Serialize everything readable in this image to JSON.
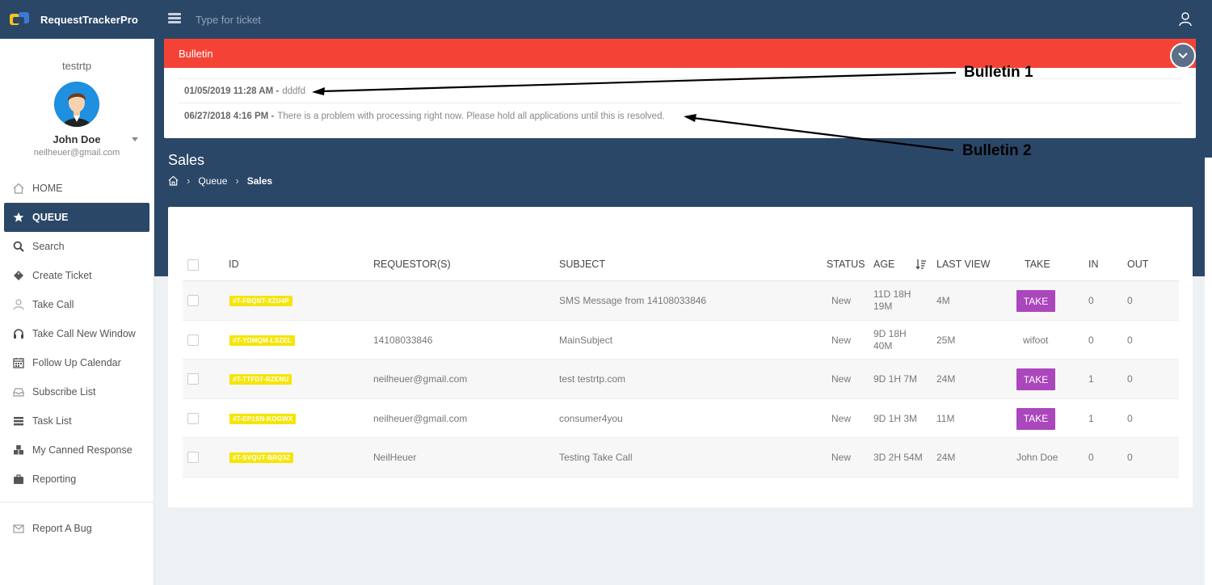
{
  "app": {
    "name": "RequestTrackerPro"
  },
  "topbar": {
    "search_placeholder": "Type for ticket"
  },
  "sidebar": {
    "username": "testrtp",
    "full_name": "John Doe",
    "email": "neilheuer@gmail.com",
    "items": [
      {
        "label": "HOME",
        "icon": "home-icon"
      },
      {
        "label": "QUEUE",
        "icon": "star-icon",
        "active": true
      },
      {
        "label": "Search",
        "icon": "search-icon"
      },
      {
        "label": "Create Ticket",
        "icon": "ticket-icon"
      },
      {
        "label": "Take Call",
        "icon": "person-icon"
      },
      {
        "label": "Take Call New Window",
        "icon": "headset-icon"
      },
      {
        "label": "Follow Up Calendar",
        "icon": "calendar-icon"
      },
      {
        "label": "Subscribe List",
        "icon": "inbox-icon"
      },
      {
        "label": "Task List",
        "icon": "list-icon"
      },
      {
        "label": "My Canned Response",
        "icon": "cubes-icon"
      },
      {
        "label": "Reporting",
        "icon": "briefcase-icon"
      }
    ],
    "bottom_item": {
      "label": "Report A Bug",
      "icon": "envelope-icon"
    }
  },
  "bulletin": {
    "title": "Bulletin",
    "entries": [
      {
        "date": "01/05/2019 11:28 AM -",
        "text": "dddfd"
      },
      {
        "date": "06/27/2018 4:16 PM -",
        "text": "There is a problem with processing right now. Please hold all applications until this is resolved."
      }
    ]
  },
  "annotations": {
    "bulletin1": "Bulletin 1",
    "bulletin2": "Bulletin 2"
  },
  "page": {
    "title": "Sales",
    "breadcrumb": {
      "queue": "Queue",
      "current": "Sales"
    }
  },
  "table": {
    "headers": {
      "id": "ID",
      "requestor": "REQUESTOR(S)",
      "subject": "SUBJECT",
      "status": "STATUS",
      "age": "AGE",
      "last_view": "LAST VIEW",
      "take": "TAKE",
      "in": "IN",
      "out": "OUT"
    },
    "rows": [
      {
        "id": "#T-FBQNT-XZU4P",
        "requestor": "",
        "subject": "SMS Message from 14108033846",
        "status": "New",
        "age1": "11D 18H",
        "age2": "19M",
        "last_view": "4M",
        "take": "TAKE",
        "take_is_button": true,
        "in": "0",
        "out": "0"
      },
      {
        "id": "#T-YDMQM-LSZEL",
        "requestor": "14108033846",
        "subject": "MainSubject",
        "status": "New",
        "age1": "9D 18H",
        "age2": "40M",
        "last_view": "25M",
        "take": "wifoot",
        "take_is_button": false,
        "in": "0",
        "out": "0"
      },
      {
        "id": "#T-TTFD7-RZENU",
        "requestor": "neilheuer@gmail.com",
        "subject": "test testrtp.com",
        "status": "New",
        "age1": "9D 1H 7M",
        "age2": "",
        "last_view": "24M",
        "take": "TAKE",
        "take_is_button": true,
        "in": "1",
        "out": "0"
      },
      {
        "id": "#T-EP1SN-KOGWX",
        "requestor": "neilheuer@gmail.com",
        "subject": "consumer4you",
        "status": "New",
        "age1": "9D 1H 3M",
        "age2": "",
        "last_view": "11M",
        "take": "TAKE",
        "take_is_button": true,
        "in": "1",
        "out": "0"
      },
      {
        "id": "#T-SVQUT-BRQ3Z",
        "requestor": "NeilHeuer",
        "subject": "Testing Take Call",
        "status": "New",
        "age1": "3D 2H 54M",
        "age2": "",
        "last_view": "24M",
        "take": "John Doe",
        "take_is_button": false,
        "in": "0",
        "out": "0"
      }
    ]
  },
  "colors": {
    "navy": "#2b4767",
    "bulletin_red": "#f44336",
    "take_purple": "#ab47bc",
    "id_yellow": "#f5e50a"
  }
}
